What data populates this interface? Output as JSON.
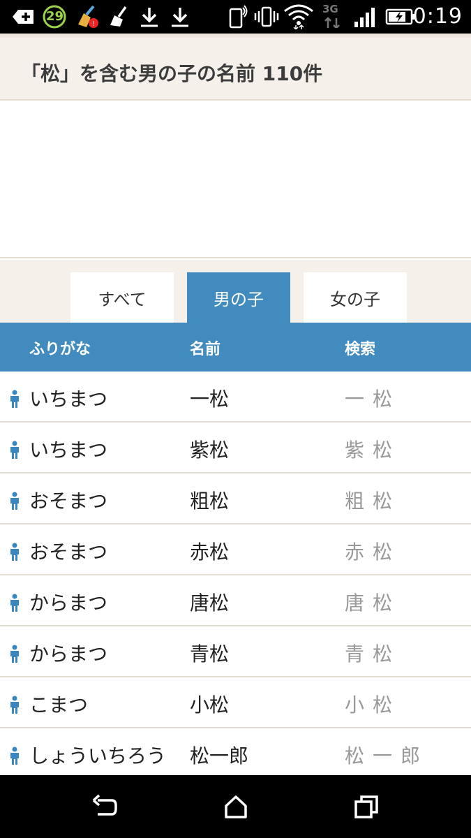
{
  "status_bar": {
    "notification_count": "29",
    "time": "0:19",
    "network_label": "3G",
    "icons": [
      "plus-icon",
      "battery-saver-icon",
      "cleaner-icon",
      "broom-icon",
      "download-icon",
      "download-icon",
      "nfc-phone-icon",
      "vibrate-icon",
      "wifi-icon",
      "3g-icon",
      "signal-icon",
      "battery-charging-icon"
    ]
  },
  "header": {
    "title": "「松」を含む男の子の名前 110件"
  },
  "tabs": [
    {
      "label": "すべて",
      "active": false
    },
    {
      "label": "男の子",
      "active": true
    },
    {
      "label": "女の子",
      "active": false
    }
  ],
  "table": {
    "columns": [
      "ふりがな",
      "名前",
      "検索"
    ],
    "rows": [
      {
        "furigana": "いちまつ",
        "name": "一松",
        "search": [
          "一",
          "松"
        ]
      },
      {
        "furigana": "いちまつ",
        "name": "紫松",
        "search": [
          "紫",
          "松"
        ]
      },
      {
        "furigana": "おそまつ",
        "name": "粗松",
        "search": [
          "粗",
          "松"
        ]
      },
      {
        "furigana": "おそまつ",
        "name": "赤松",
        "search": [
          "赤",
          "松"
        ]
      },
      {
        "furigana": "からまつ",
        "name": "唐松",
        "search": [
          "唐",
          "松"
        ]
      },
      {
        "furigana": "からまつ",
        "name": "青松",
        "search": [
          "青",
          "松"
        ]
      },
      {
        "furigana": "こまつ",
        "name": "小松",
        "search": [
          "小",
          "松"
        ]
      },
      {
        "furigana": "しょういちろう",
        "name": "松一郎",
        "search": [
          "松",
          "一",
          "郎"
        ]
      }
    ]
  },
  "colors": {
    "accent": "#428bbf",
    "header_bg": "#f5f1ea",
    "search_text": "#999999",
    "male_icon": "#3a87c0"
  },
  "nav_bar": {
    "icons": [
      "back-icon",
      "home-icon",
      "recents-icon"
    ]
  }
}
